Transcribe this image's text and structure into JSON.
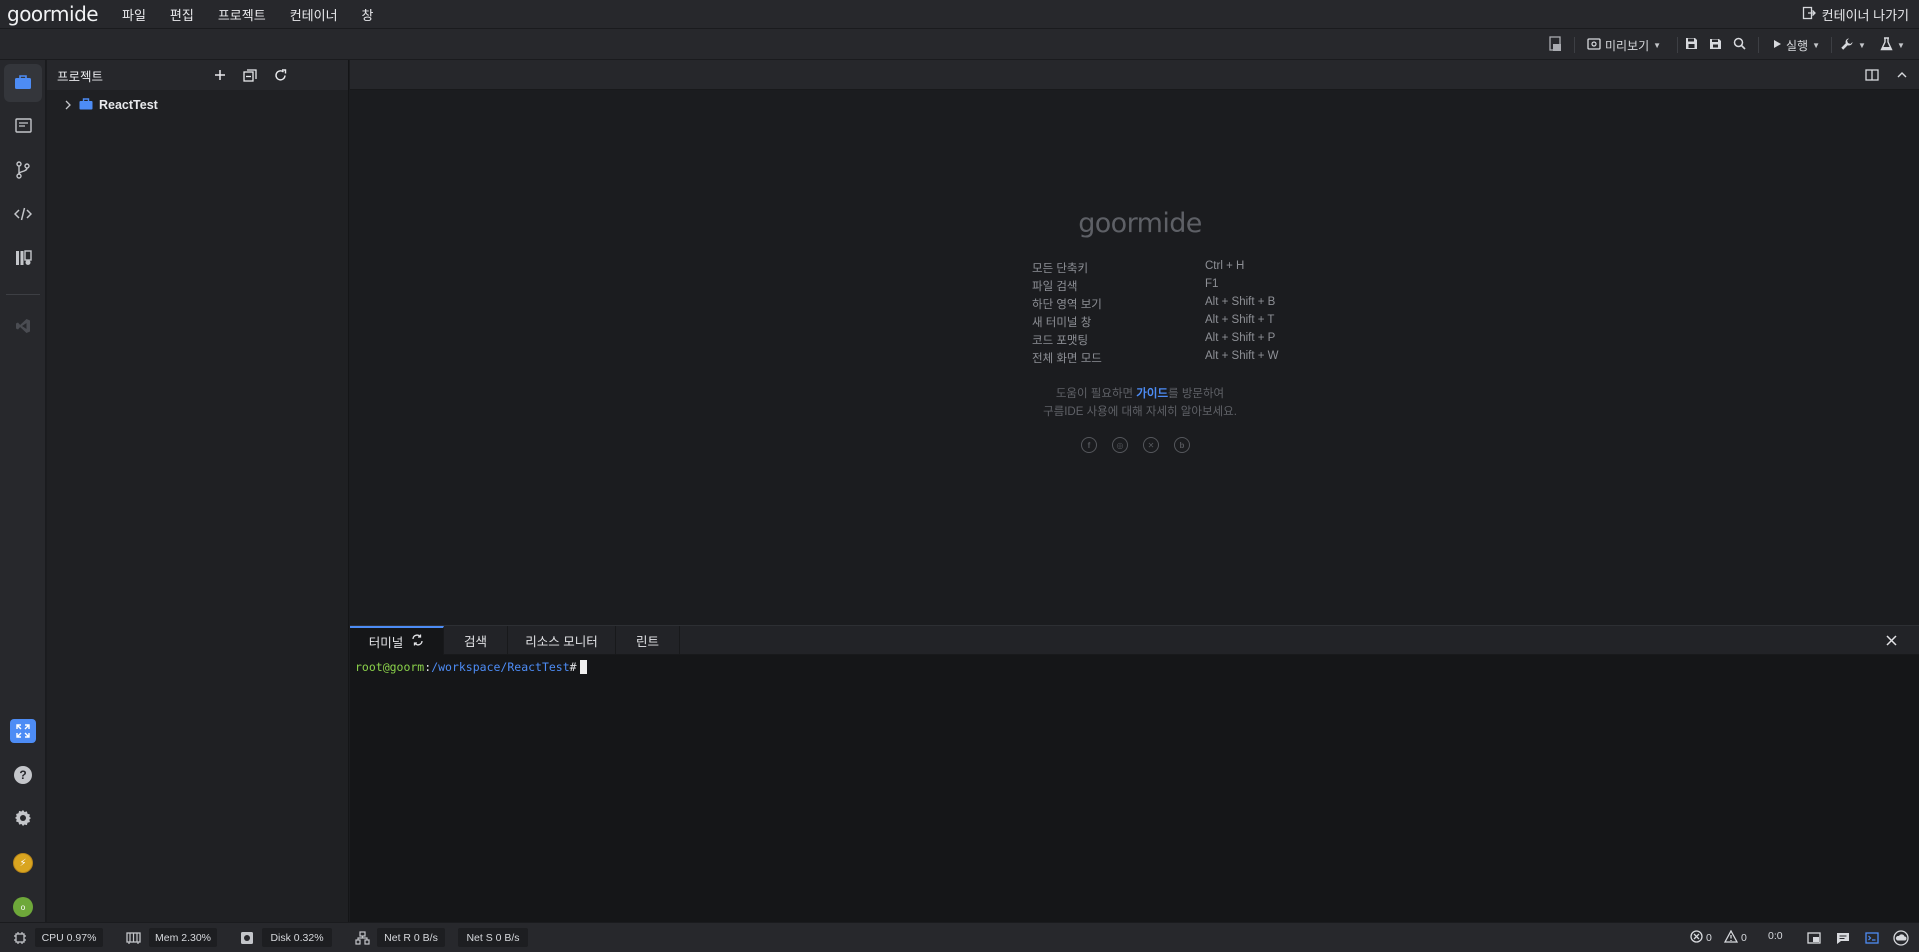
{
  "app": {
    "logo": "goormide"
  },
  "menubar": {
    "items": [
      "파일",
      "편집",
      "프로젝트",
      "컨테이너",
      "창"
    ],
    "exit_label": "컨테이너 나가기"
  },
  "toolbar": {
    "preview_label": "미리보기",
    "run_label": "실행"
  },
  "explorer": {
    "title": "프로젝트",
    "root_name": "ReactTest"
  },
  "welcome": {
    "logo": "goormide",
    "shortcuts": [
      {
        "label": "모든 단축키",
        "keys": "Ctrl + H"
      },
      {
        "label": "파일 검색",
        "keys": "F1"
      },
      {
        "label": "하단 영역 보기",
        "keys": "Alt + Shift + B"
      },
      {
        "label": "새 터미널 창",
        "keys": "Alt + Shift + T"
      },
      {
        "label": "코드 포맷팅",
        "keys": "Alt + Shift + P"
      },
      {
        "label": "전체 화면 모드",
        "keys": "Alt + Shift + W"
      }
    ],
    "help_prefix": "도움이 필요하면 ",
    "help_link": "가이드",
    "help_suffix": "를 방문하여",
    "help_line2": "구름IDE 사용에 대해 자세히 알아보세요."
  },
  "panel": {
    "tabs": [
      "터미널",
      "검색",
      "리소스 모니터",
      "린트"
    ],
    "terminal": {
      "user": "root@goorm",
      "colon": ":",
      "path": "/workspace/ReactTest",
      "prompt": "#"
    }
  },
  "statusbar": {
    "cpu": "CPU 0.97%",
    "mem": "Mem 2.30%",
    "disk": "Disk 0.32%",
    "net_r": "Net R 0 B/s",
    "net_s": "Net S 0 B/s",
    "errors": "0",
    "warnings": "0",
    "cursor_pos": "0:0"
  },
  "colors": {
    "accent": "#4d8cf5",
    "terminal_user": "#8ad14a",
    "background": "#1b1c1f"
  }
}
